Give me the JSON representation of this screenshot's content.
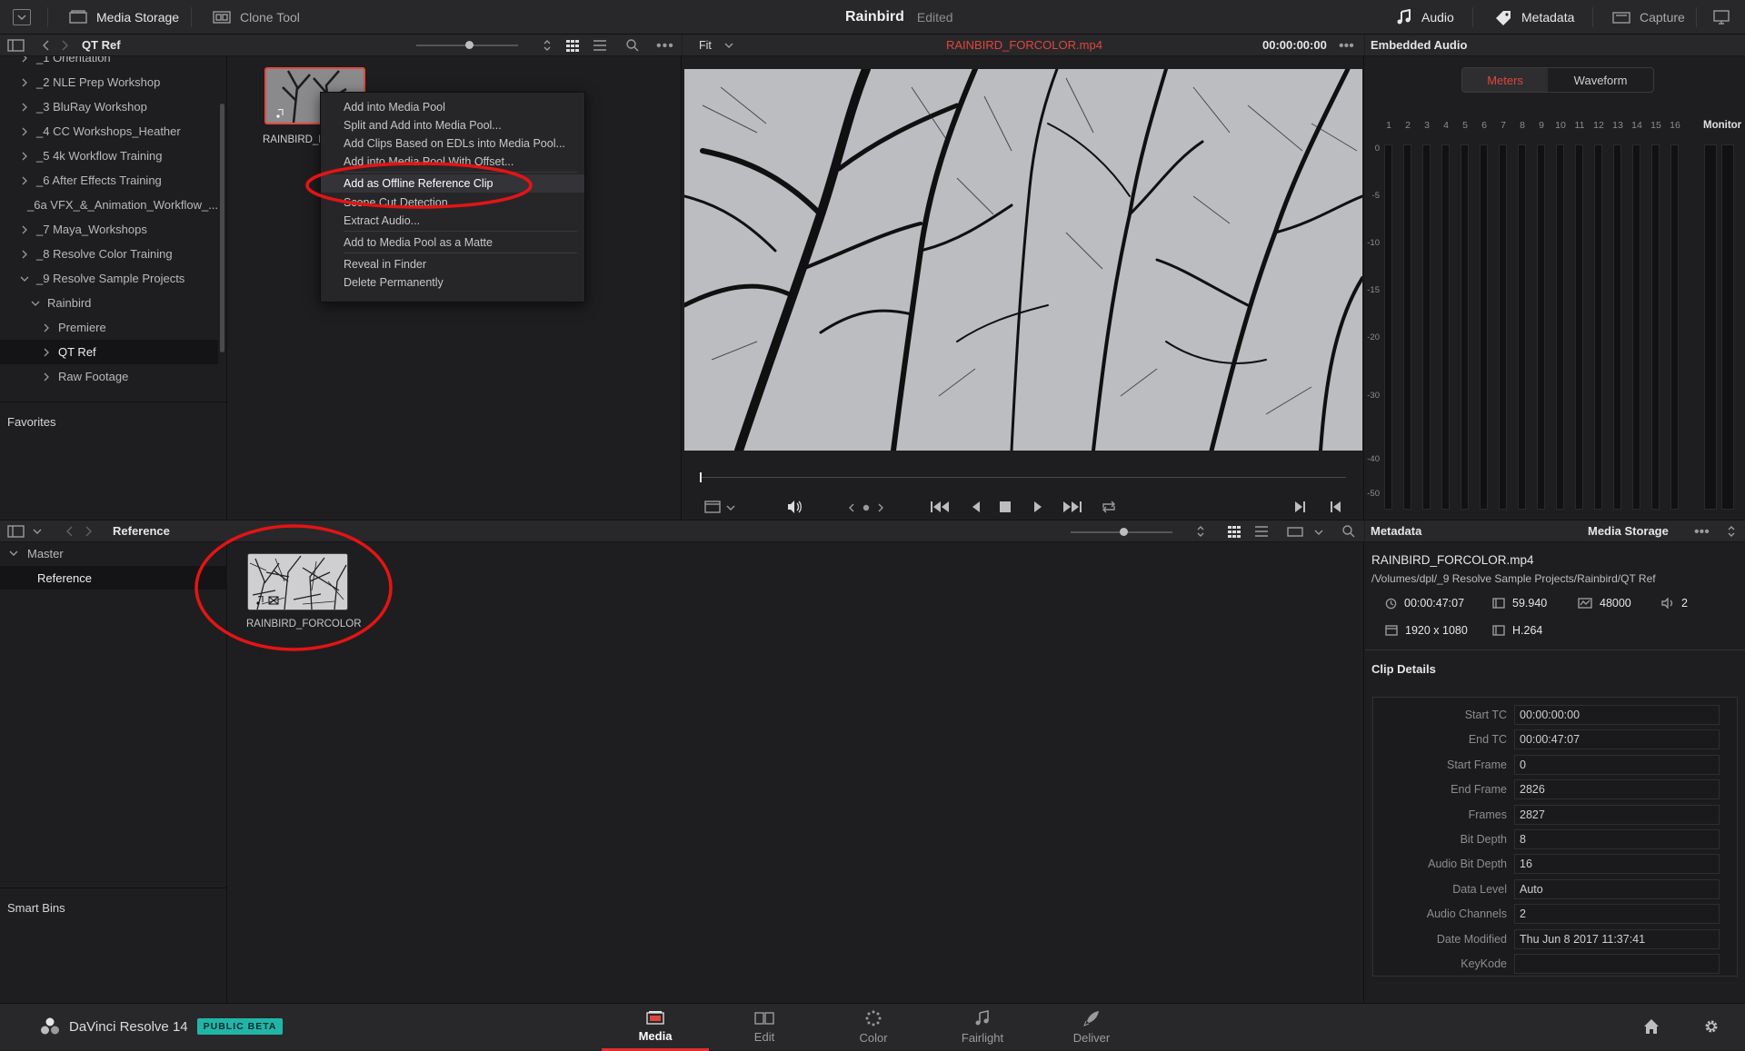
{
  "app": {
    "project_title": "Rainbird",
    "project_status": "Edited",
    "brand": "DaVinci Resolve 14",
    "beta_badge": "PUBLIC BETA"
  },
  "topbar": {
    "left_tabs": [
      "Media Storage",
      "Clone Tool"
    ],
    "right_tabs": [
      "Audio",
      "Metadata",
      "Capture"
    ]
  },
  "storage": {
    "path_title": "QT Ref",
    "tree": [
      {
        "label": "_1 Orientation",
        "level": 0
      },
      {
        "label": "_2 NLE Prep Workshop",
        "level": 0
      },
      {
        "label": "_3 BluRay Workshop",
        "level": 0
      },
      {
        "label": "_4 CC Workshops_Heather",
        "level": 0
      },
      {
        "label": "_5 4k Workflow Training",
        "level": 0
      },
      {
        "label": "_6 After Effects Training",
        "level": 0
      },
      {
        "label": "_6a VFX_&_Animation_Workflow_...",
        "level": 0
      },
      {
        "label": "_7 Maya_Workshops",
        "level": 0
      },
      {
        "label": "_8 Resolve Color Training",
        "level": 0
      },
      {
        "label": "_9 Resolve Sample Projects",
        "level": 0
      },
      {
        "label": "Rainbird",
        "level": 1
      },
      {
        "label": "Premiere",
        "level": 2
      },
      {
        "label": "QT Ref",
        "level": 2
      },
      {
        "label": "Raw Footage",
        "level": 2
      }
    ],
    "favorites_label": "Favorites",
    "clip_name": "RAINBIRD_FORCOLOR.mp4",
    "clip_name_truncated": "RAINBIRD_FC"
  },
  "context_menu": {
    "items": [
      "Add into Media Pool",
      "Split and Add into Media Pool...",
      "Add Clips Based on EDLs into Media Pool...",
      "Add into Media Pool With Offset...",
      "Add as Offline Reference Clip",
      "Scene Cut Detection...",
      "Extract Audio...",
      "Add to Media Pool as a Matte",
      "Reveal in Finder",
      "Delete Permanently"
    ],
    "highlighted": "Add as Offline Reference Clip"
  },
  "viewer": {
    "zoom": "Fit",
    "clip_title": "RAINBIRD_FORCOLOR.mp4",
    "timecode": "00:00:00:00"
  },
  "audio": {
    "title": "Embedded Audio",
    "tabs": [
      "Meters",
      "Waveform"
    ],
    "active_tab": "Meters",
    "channels": [
      "1",
      "2",
      "3",
      "4",
      "5",
      "6",
      "7",
      "8",
      "9",
      "10",
      "11",
      "12",
      "13",
      "14",
      "15",
      "16"
    ],
    "db_scale": [
      "0",
      "-5",
      "-10",
      "-15",
      "-20",
      "-30",
      "-40",
      "-50"
    ],
    "monitor_label": "Monitor"
  },
  "media_pool": {
    "title": "Reference",
    "bins": [
      "Master",
      "Reference"
    ],
    "smart_bins_label": "Smart Bins",
    "clip_label": "RAINBIRD_FORCOLOR"
  },
  "metadata": {
    "title": "Metadata",
    "source": "Media Storage",
    "file_name": "RAINBIRD_FORCOLOR.mp4",
    "file_path": "/Volumes/dpl/_9 Resolve Sample Projects/Rainbird/QT Ref",
    "duration": "00:00:47:07",
    "fps": "59.940",
    "audio_rate": "48000",
    "audio_channels": "2",
    "resolution": "1920 x 1080",
    "codec": "H.264",
    "clip_details_title": "Clip Details",
    "fields": [
      {
        "label": "Start TC",
        "value": "00:00:00:00"
      },
      {
        "label": "End TC",
        "value": "00:00:47:07"
      },
      {
        "label": "Start Frame",
        "value": "0"
      },
      {
        "label": "End Frame",
        "value": "2826"
      },
      {
        "label": "Frames",
        "value": "2827"
      },
      {
        "label": "Bit Depth",
        "value": "8"
      },
      {
        "label": "Audio Bit Depth",
        "value": "16"
      },
      {
        "label": "Data Level",
        "value": "Auto"
      },
      {
        "label": "Audio Channels",
        "value": "2"
      },
      {
        "label": "Date Modified",
        "value": "Thu Jun 8 2017 11:37:41"
      },
      {
        "label": "KeyKode",
        "value": ""
      }
    ]
  },
  "pages": [
    "Media",
    "Edit",
    "Color",
    "Fairlight",
    "Deliver"
  ],
  "active_page": "Media",
  "colors": {
    "accent_red": "#e02f2f",
    "beta_badge": "#21b5a8",
    "annotation_red": "#e41414"
  }
}
